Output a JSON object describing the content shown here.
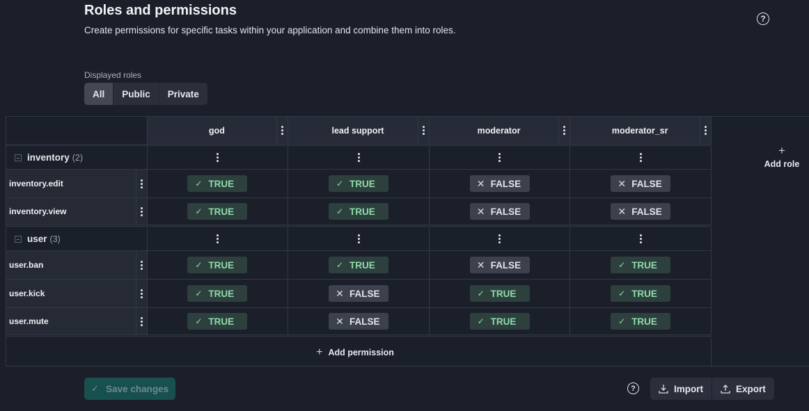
{
  "header": {
    "title": "Roles and permissions",
    "subtitle": "Create permissions for specific tasks within your application and combine them into roles.",
    "help_icon": "question-circle-icon"
  },
  "role_filter": {
    "label": "Displayed roles",
    "options": [
      "All",
      "Public",
      "Private"
    ],
    "selected": "All"
  },
  "roles": [
    "god",
    "lead support",
    "moderator",
    "moderator_sr"
  ],
  "groups": [
    {
      "name": "inventory",
      "count": "(2)",
      "permissions": [
        {
          "name": "inventory.edit",
          "values": [
            "TRUE",
            "TRUE",
            "FALSE",
            "FALSE"
          ]
        },
        {
          "name": "inventory.view",
          "values": [
            "TRUE",
            "TRUE",
            "FALSE",
            "FALSE"
          ]
        }
      ]
    },
    {
      "name": "user",
      "count": "(3)",
      "permissions": [
        {
          "name": "user.ban",
          "values": [
            "TRUE",
            "TRUE",
            "FALSE",
            "TRUE"
          ]
        },
        {
          "name": "user.kick",
          "values": [
            "TRUE",
            "FALSE",
            "TRUE",
            "TRUE"
          ]
        },
        {
          "name": "user.mute",
          "values": [
            "TRUE",
            "FALSE",
            "TRUE",
            "TRUE"
          ]
        }
      ]
    }
  ],
  "actions": {
    "add_role": "Add role",
    "add_permission": "Add permission",
    "save_changes": "Save changes",
    "import": "Import",
    "export": "Export"
  },
  "colors": {
    "true_badge_bg": "#2d403e",
    "true_badge_text": "#8fdcaa",
    "false_badge_bg": "#3c414d",
    "save_button_bg": "#184f4f"
  }
}
